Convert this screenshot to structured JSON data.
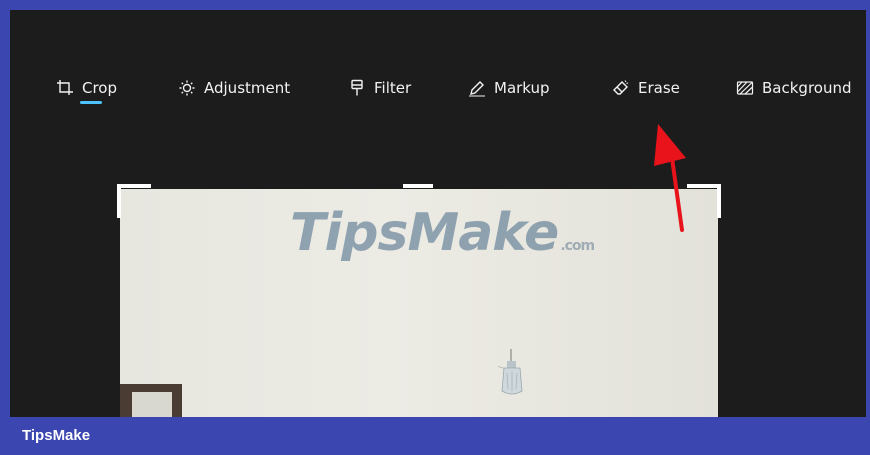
{
  "toolbar": {
    "items": [
      {
        "label": "Crop",
        "icon": "crop-icon",
        "active": true
      },
      {
        "label": "Adjustment",
        "icon": "brightness-icon",
        "active": false
      },
      {
        "label": "Filter",
        "icon": "filter-icon",
        "active": false
      },
      {
        "label": "Markup",
        "icon": "pen-icon",
        "active": false
      },
      {
        "label": "Erase",
        "icon": "eraser-icon",
        "active": false
      },
      {
        "label": "Background",
        "icon": "background-icon",
        "active": false
      }
    ]
  },
  "watermark": {
    "brand": "TipsMake",
    "suffix": ".com"
  },
  "footer": {
    "brand": "TipsMake"
  },
  "colors": {
    "accent": "#4cc2ff",
    "frame": "#3b46b0",
    "arrow": "#e8131b",
    "app_bg": "#1c1c1c"
  }
}
